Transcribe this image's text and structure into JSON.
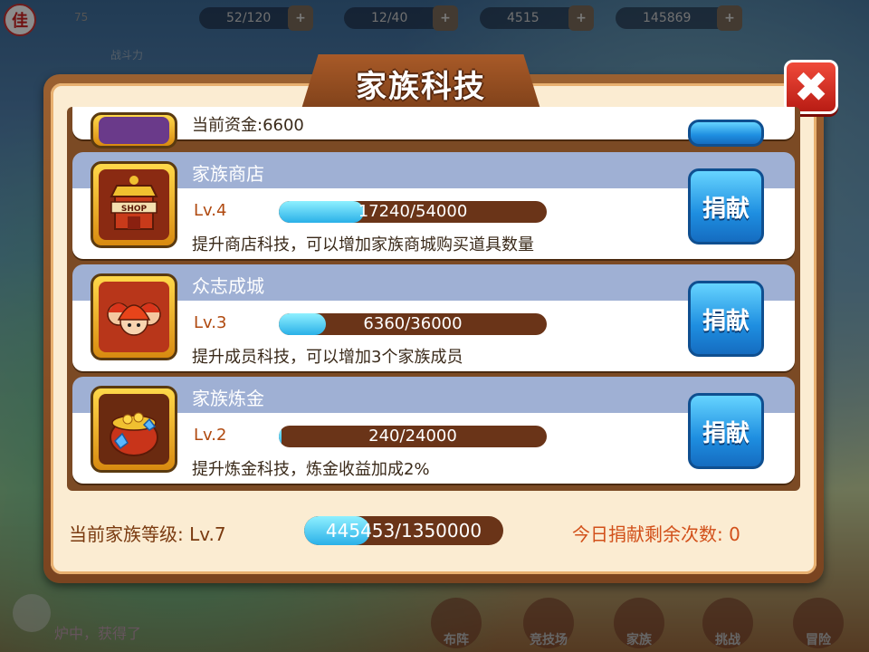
{
  "top": {
    "avatar_char": "佳",
    "player_level": "75",
    "combat_label": "战斗力",
    "stamina": "52/120",
    "energy": "12/40",
    "diamonds": "4515",
    "gold": "145869"
  },
  "dialog": {
    "title": "家族科技",
    "close_icon": "✖",
    "partial_item": {
      "funds_label": "当前资金:6600"
    },
    "items": [
      {
        "name": "家族商店",
        "level": "Lv.4",
        "progress_text": "17240/54000",
        "progress": 0.319,
        "description": "提升商店科技，可以增加家族商城购买道具数量",
        "donate_label": "捐献",
        "icon": "shop-icon"
      },
      {
        "name": "众志成城",
        "level": "Lv.3",
        "progress_text": "6360/36000",
        "progress": 0.177,
        "description": "提升成员科技，可以增加3个家族成员",
        "donate_label": "捐献",
        "icon": "members-icon"
      },
      {
        "name": "家族炼金",
        "level": "Lv.2",
        "progress_text": "240/24000",
        "progress": 0.01,
        "description": "提升炼金科技，炼金收益加成2%",
        "donate_label": "捐献",
        "icon": "alchemy-pot-icon"
      }
    ],
    "footer": {
      "family_level": "当前家族等级: Lv.7",
      "progress_text": "445453/1350000",
      "progress": 0.33,
      "donate_times": "今日捐献剩余次数: 0"
    }
  },
  "bottom_nav": [
    "布阵",
    "竞技场",
    "家族",
    "挑战",
    "冒险"
  ],
  "chat_text": "炉中，获得了"
}
